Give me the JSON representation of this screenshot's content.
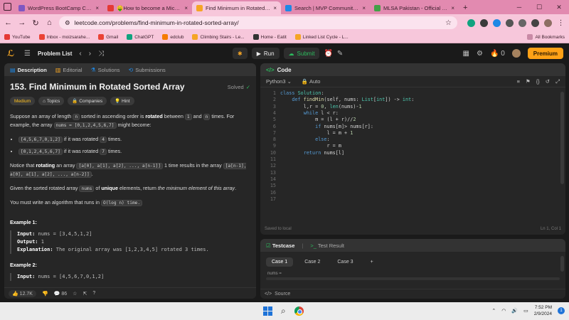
{
  "browser": {
    "tabs": [
      {
        "title": "WordPress BootCamp Complet",
        "color": "#7e57c2",
        "active": false
      },
      {
        "title": "🤑How to become a Microsof",
        "color": "#e53935",
        "active": false
      },
      {
        "title": "Find Minimum in Rotated Sorte",
        "color": "#f5a524",
        "active": true
      },
      {
        "title": "Search | MVP Communities",
        "color": "#1e88e5",
        "active": false
      },
      {
        "title": "MLSA Pakistan - Official Home",
        "color": "#43a047",
        "active": false
      }
    ],
    "tab_close": "×",
    "new_tab": "+",
    "url": "leetcode.com/problems/find-minimum-in-rotated-sorted-array/",
    "bookmarks": [
      {
        "label": "YouTube",
        "color": "#e53935"
      },
      {
        "label": "Inbox - moizsarahe...",
        "color": "#ea4335"
      },
      {
        "label": "Gmail",
        "color": "#ea4335"
      },
      {
        "label": "ChatGPT",
        "color": "#10a37f"
      },
      {
        "label": "edclub",
        "color": "#f57c00"
      },
      {
        "label": "Climbing Stairs - Le...",
        "color": "#f5a524"
      },
      {
        "label": "Home - Eatit",
        "color": "#333333"
      },
      {
        "label": "Linked List Cycle - L...",
        "color": "#f5a524"
      }
    ],
    "all_bookmarks": "All Bookmarks"
  },
  "leetcode": {
    "problem_list": "Problem List",
    "run": "Run",
    "submit": "Submit",
    "streak": "0",
    "premium": "Premium"
  },
  "left": {
    "tabs": [
      "Description",
      "Editorial",
      "Solutions",
      "Submissions"
    ],
    "title": "153. Find Minimum in Rotated Sorted Array",
    "solved": "Solved",
    "chips": [
      "Medium",
      "Topics",
      "Companies",
      "Hint"
    ],
    "p1a": "Suppose an array of length ",
    "p1_n": "n",
    "p1b": " sorted in ascending order is ",
    "p1_rot": "rotated",
    "p1c": " between ",
    "p1_1": "1",
    "p1d": " and ",
    "p1_n2": "n",
    "p1e": " times. For example, the array ",
    "p1_arr": "nums = [0,1,2,4,5,6,7]",
    "p1f": " might become:",
    "li1_code": "[4,5,6,7,0,1,2]",
    "li1_text": " if it was rotated ",
    "li1_n": "4",
    "li1_end": " times.",
    "li2_code": "[0,1,2,4,5,6,7]",
    "li2_text": " if it was rotated ",
    "li2_n": "7",
    "li2_end": " times.",
    "p2a": "Notice that ",
    "p2_rot": "rotating",
    "p2b": " an array ",
    "p2_arr": "[a[0], a[1], a[2], ..., a[n-1]]",
    "p2c": " 1 time results in the array ",
    "p2_arr2": "[a[n-1], a[0], a[1], a[2], ..., a[n-2]]",
    "p2d": ".",
    "p3a": "Given the sorted rotated array ",
    "p3_nums": "nums",
    "p3b": " of ",
    "p3_unique": "unique",
    "p3c": " elements, return ",
    "p3_it": "the minimum element of this array",
    "p3d": ".",
    "p4a": "You must write an algorithm that runs in ",
    "p4_code": "O(log n) time.",
    "ex1": "Example 1:",
    "ex1_input_l": "Input:",
    "ex1_input": " nums = [3,4,5,1,2]",
    "ex1_output_l": "Output:",
    "ex1_output": " 1",
    "ex1_expl_l": "Explanation:",
    "ex1_expl": " The original array was [1,2,3,4,5] rotated 3 times.",
    "ex2": "Example 2:",
    "ex2_input_l": "Input:",
    "ex2_input": " nums = [4,5,6,7,0,1,2]",
    "likes": "12.7K",
    "comments": "86"
  },
  "code": {
    "header": "Code",
    "language": "Python3",
    "auto": "Auto",
    "lines": [
      "class Solution:",
      "    def findMin(self, nums: List[int]) -> int:",
      "        l,r = 0, len(nums)-1",
      "        while l < r:",
      "            m = (l + r)//2",
      "            if nums[m]> nums[r]:",
      "                l = m + 1",
      "            else:",
      "                r = m",
      "        return nums[l]",
      "",
      "",
      "",
      "",
      "",
      "",
      ""
    ],
    "saved": "Saved to local",
    "position": "Ln 1, Col 1"
  },
  "testcase": {
    "tab1": "Testcase",
    "tab2": "Test Result",
    "cases": [
      "Case 1",
      "Case 2",
      "Case 3"
    ],
    "add": "+",
    "label": "nums =",
    "source": "Source"
  },
  "taskbar": {
    "time": "7:52 PM",
    "date": "2/9/2024",
    "notif_count": "1"
  }
}
